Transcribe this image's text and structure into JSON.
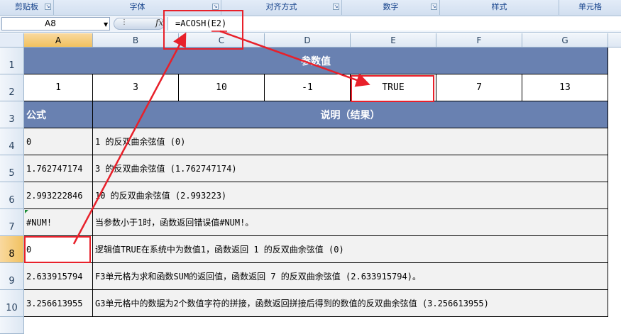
{
  "ribbon": {
    "groups": [
      "剪贴板",
      "字体",
      "对齐方式",
      "数字",
      "样式",
      "单元格"
    ]
  },
  "formula_bar": {
    "name_box": "A8",
    "fx": "fx",
    "formula": "=ACOSH(E2)"
  },
  "columns": [
    "A",
    "B",
    "C",
    "D",
    "E",
    "F",
    "G"
  ],
  "rows": [
    "1",
    "2",
    "3",
    "4",
    "5",
    "6",
    "7",
    "8",
    "9",
    "10"
  ],
  "sheet": {
    "title": "参数值",
    "params": [
      "1",
      "3",
      "10",
      "-1",
      "TRUE",
      "7",
      "13"
    ],
    "header_formula": "公式",
    "header_desc": "说明（结果）",
    "results": [
      {
        "value": "0",
        "desc": "1 的反双曲余弦值 (0)"
      },
      {
        "value": "1.762747174",
        "desc": "3 的反双曲余弦值 (1.762747174)"
      },
      {
        "value": "2.993222846",
        "desc": "10 的反双曲余弦值 (2.993223)"
      },
      {
        "value": "#NUM!",
        "desc": "当参数小于1时，函数返回错误值#NUM!。"
      },
      {
        "value": "0",
        "desc": "逻辑值TRUE在系统中为数值1，函数返回 1 的反双曲余弦值 (0)"
      },
      {
        "value": "2.633915794",
        "desc": "F3单元格为求和函数SUM的返回值，函数返回 7 的反双曲余弦值 (2.633915794)。"
      },
      {
        "value": "3.256613955",
        "desc": "G3单元格中的数据为2个数值字符的拼接，函数返回拼接后得到的数值的反双曲余弦值 (3.256613955)"
      }
    ]
  },
  "colors": {
    "header_fill": "#6981b1",
    "annotation": "#e8202a",
    "selected_header": "#f1c15f"
  }
}
